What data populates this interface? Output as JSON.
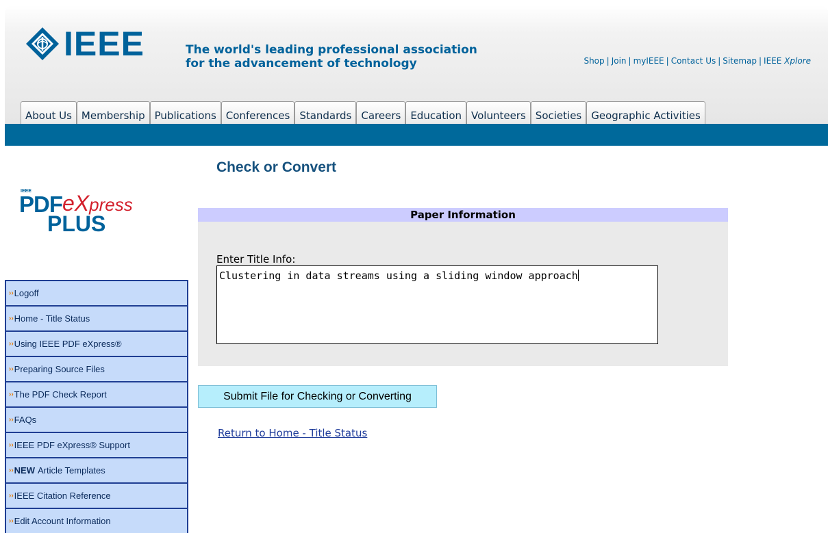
{
  "header": {
    "logo_text": "IEEE",
    "tagline_line1": "The world's leading professional association",
    "tagline_line2": "for the advancement of technology",
    "top_links": [
      "Shop",
      "Join",
      "myIEEE",
      "Contact Us",
      "Sitemap"
    ],
    "xplore_prefix": "IEEE",
    "xplore_italic": "Xplore",
    "brand_color": "#00629b"
  },
  "tabs": [
    "About Us",
    "Membership",
    "Publications",
    "Conferences",
    "Standards",
    "Careers",
    "Education",
    "Volunteers",
    "Societies",
    "Geographic Activities"
  ],
  "page_title": "Check or Convert",
  "pdf_logo": {
    "ieee": "IEEE",
    "pdf": "PDF",
    "e": "e",
    "x": "X",
    "press": "press",
    "plus": "PLUS"
  },
  "sidebar": {
    "items": [
      {
        "bold": "",
        "label": "Logoff"
      },
      {
        "bold": "",
        "label": "Home - Title Status"
      },
      {
        "bold": "",
        "label": "Using IEEE PDF eXpress®"
      },
      {
        "bold": "",
        "label": "Preparing Source Files"
      },
      {
        "bold": "",
        "label": "The PDF Check Report"
      },
      {
        "bold": "",
        "label": "FAQs"
      },
      {
        "bold": "",
        "label": "IEEE PDF eXpress® Support"
      },
      {
        "bold": "NEW",
        "label": "Article Templates"
      },
      {
        "bold": "",
        "label": "IEEE Citation Reference"
      },
      {
        "bold": "",
        "label": "Edit Account Information"
      }
    ],
    "chevron": "››"
  },
  "panel": {
    "header": "Paper Information",
    "title_label": "Enter Title Info:",
    "title_value": "Clustering in data streams using a sliding window approach"
  },
  "submit_label": "Submit File for Checking or Converting",
  "return_link": "Return to Home - Title Status"
}
